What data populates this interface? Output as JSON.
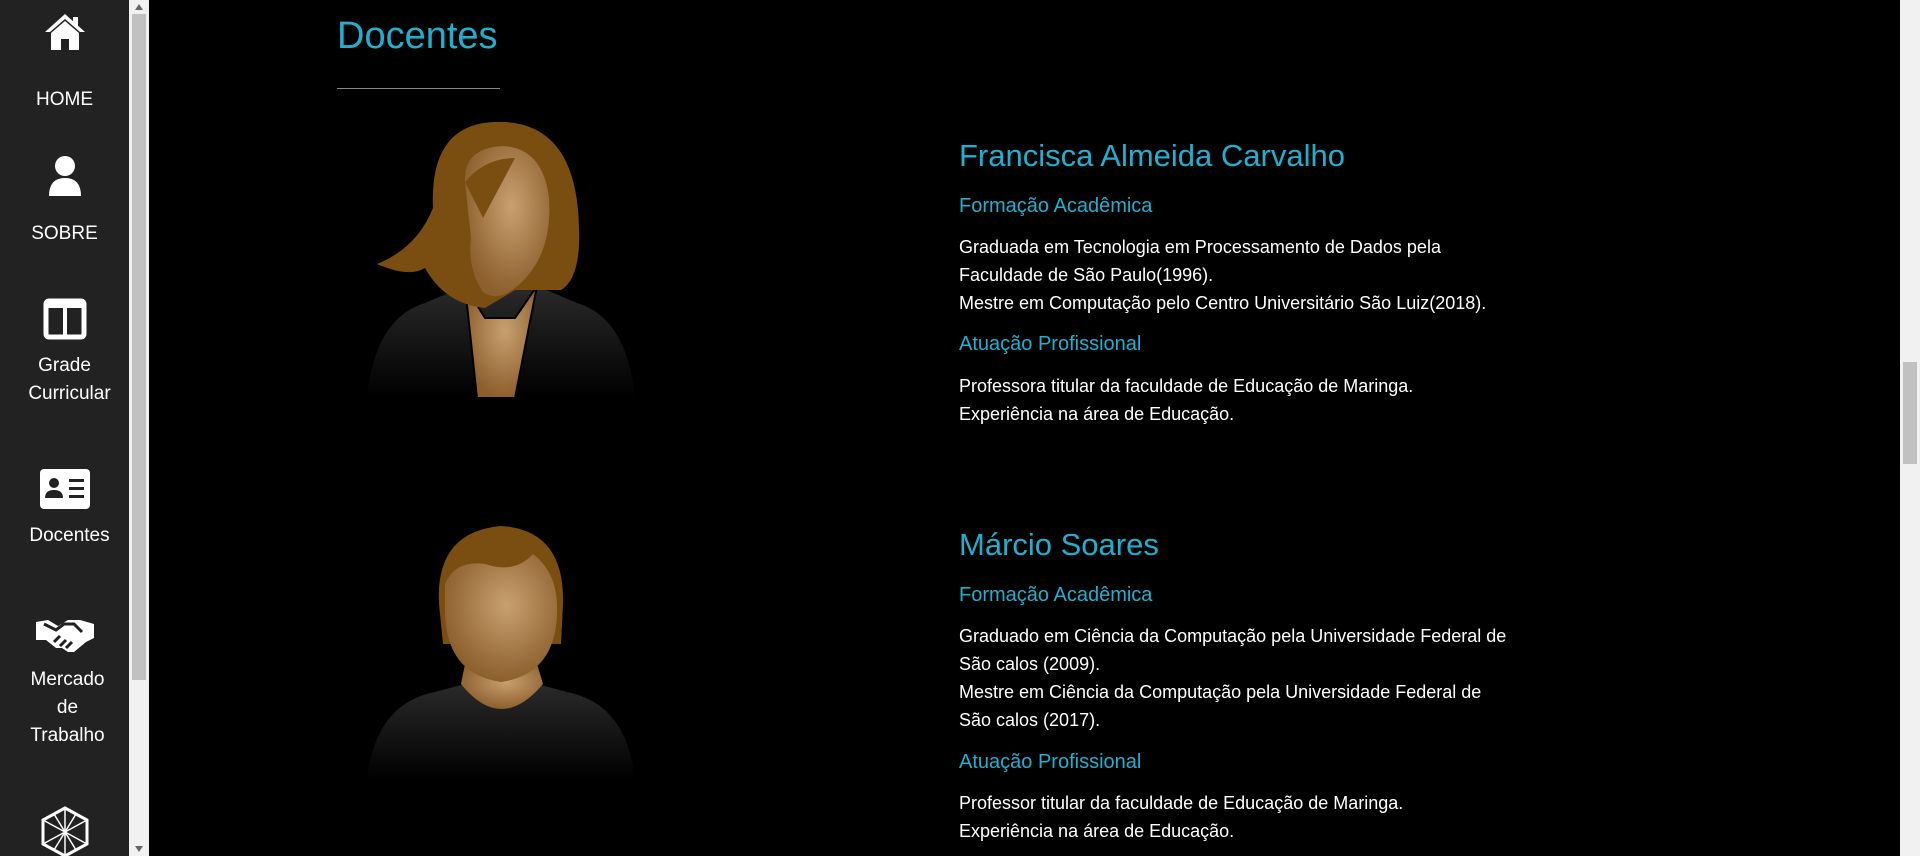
{
  "sidebar": {
    "items": [
      {
        "label": "HOME",
        "icon": "home-icon"
      },
      {
        "label": "SOBRE",
        "icon": "user-icon"
      },
      {
        "label": "Grade Curricular",
        "label_lines": [
          "Grade",
          "Curricular"
        ],
        "icon": "columns-icon"
      },
      {
        "label": "Docentes",
        "icon": "id-card-icon"
      },
      {
        "label": "Mercado de Trabalho",
        "label_lines": [
          "Mercado",
          "de",
          "Trabalho"
        ],
        "icon": "handshake-icon"
      },
      {
        "label": "",
        "icon": "hexagon-network-icon"
      }
    ]
  },
  "main": {
    "section_title": "Docentes",
    "teachers": [
      {
        "name": "Francisca Almeida Carvalho",
        "avatar": "female-avatar",
        "formacao_title": "Formação Acadêmica",
        "formacao_lines": [
          "Graduada em Tecnologia em Processamento de Dados pela",
          "Faculdade de São Paulo(1996).",
          "Mestre em Computação pelo Centro Universitário São Luiz(2018)."
        ],
        "atuacao_title": "Atuação Profissional",
        "atuacao_lines": [
          "Professora titular da faculdade de Educação de Maringa.",
          "Experiência na área de Educação."
        ]
      },
      {
        "name": "Márcio Soares",
        "avatar": "male-avatar",
        "formacao_title": "Formação Acadêmica",
        "formacao_lines": [
          "Graduado em Ciência da Computação pela Universidade Federal de",
          "São calos (2009).",
          "Mestre em Ciência da Computação pela Universidade Federal de",
          "São calos (2017)."
        ],
        "atuacao_title": "Atuação Profissional",
        "atuacao_lines": [
          "Professor titular da faculdade de Educação de Maringa.",
          "Experiência na área de Educação."
        ]
      }
    ]
  },
  "colors": {
    "accent": "#1fb0d0",
    "sidebar_bg": "#222222",
    "page_bg": "#000000"
  }
}
